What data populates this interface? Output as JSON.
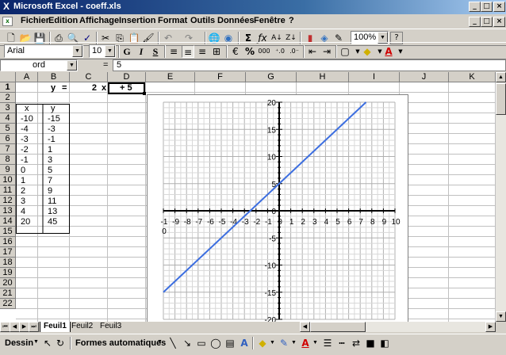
{
  "window": {
    "title": "Microsoft Excel - coeff.xls",
    "app_icon": "excel-x-icon"
  },
  "menu": [
    "Fichier",
    "Edition",
    "Affichage",
    "Insertion",
    "Format",
    "Outils",
    "Données",
    "Fenêtre",
    "?"
  ],
  "toolbar": {
    "zoom": "100%",
    "font": "Arial",
    "size": "10",
    "bold": "G",
    "italic": "I",
    "underline": "S",
    "percent": "%",
    "thousands": "000"
  },
  "formula": {
    "name_box": "ord",
    "equals": "=",
    "content": "5"
  },
  "columns": [
    "A",
    "B",
    "C",
    "D",
    "E",
    "F",
    "G",
    "H",
    "I",
    "J",
    "K"
  ],
  "rows": [
    "1",
    "2",
    "3",
    "4",
    "5",
    "6",
    "7",
    "8",
    "9",
    "10",
    "11",
    "12",
    "13",
    "14",
    "15",
    "16",
    "17",
    "18",
    "19",
    "20",
    "21",
    "22"
  ],
  "equation": {
    "y": "y",
    "eq": "=",
    "coef": "2",
    "x": "x",
    "offset": "+ 5"
  },
  "table": {
    "headers": [
      "x",
      "y"
    ],
    "x": [
      "-10",
      "-4",
      "-3",
      "-2",
      "-1",
      "0",
      "1",
      "2",
      "3",
      "4",
      "20"
    ],
    "y": [
      "-15",
      "-3",
      "-1",
      "1",
      "3",
      "5",
      "7",
      "9",
      "11",
      "13",
      "45"
    ]
  },
  "sheets": [
    "Feuil1",
    "Feuil2",
    "Feuil3"
  ],
  "drawing": {
    "menu": "Dessin",
    "autoshapes": "Formes automatiques"
  },
  "chart_data": {
    "type": "line",
    "x_tick_labels": [
      "-1",
      "-9",
      "-8",
      "-7",
      "-6",
      "-5",
      "-4",
      "-3",
      "-2",
      "-1",
      "0",
      "1",
      "2",
      "3",
      "4",
      "5",
      "6",
      "7",
      "8",
      "9",
      "10"
    ],
    "x_tick_extra": "0",
    "y_tick_labels": [
      "20",
      "15",
      "10",
      "5",
      "0",
      "-5",
      "-10",
      "-15",
      "-20"
    ],
    "xlim": [
      -10,
      10
    ],
    "ylim": [
      -20,
      20
    ],
    "grid": true,
    "series": [
      {
        "x": [
          -10,
          7.5
        ],
        "y": [
          -15,
          20
        ],
        "color": "#3c6ee0"
      }
    ]
  }
}
